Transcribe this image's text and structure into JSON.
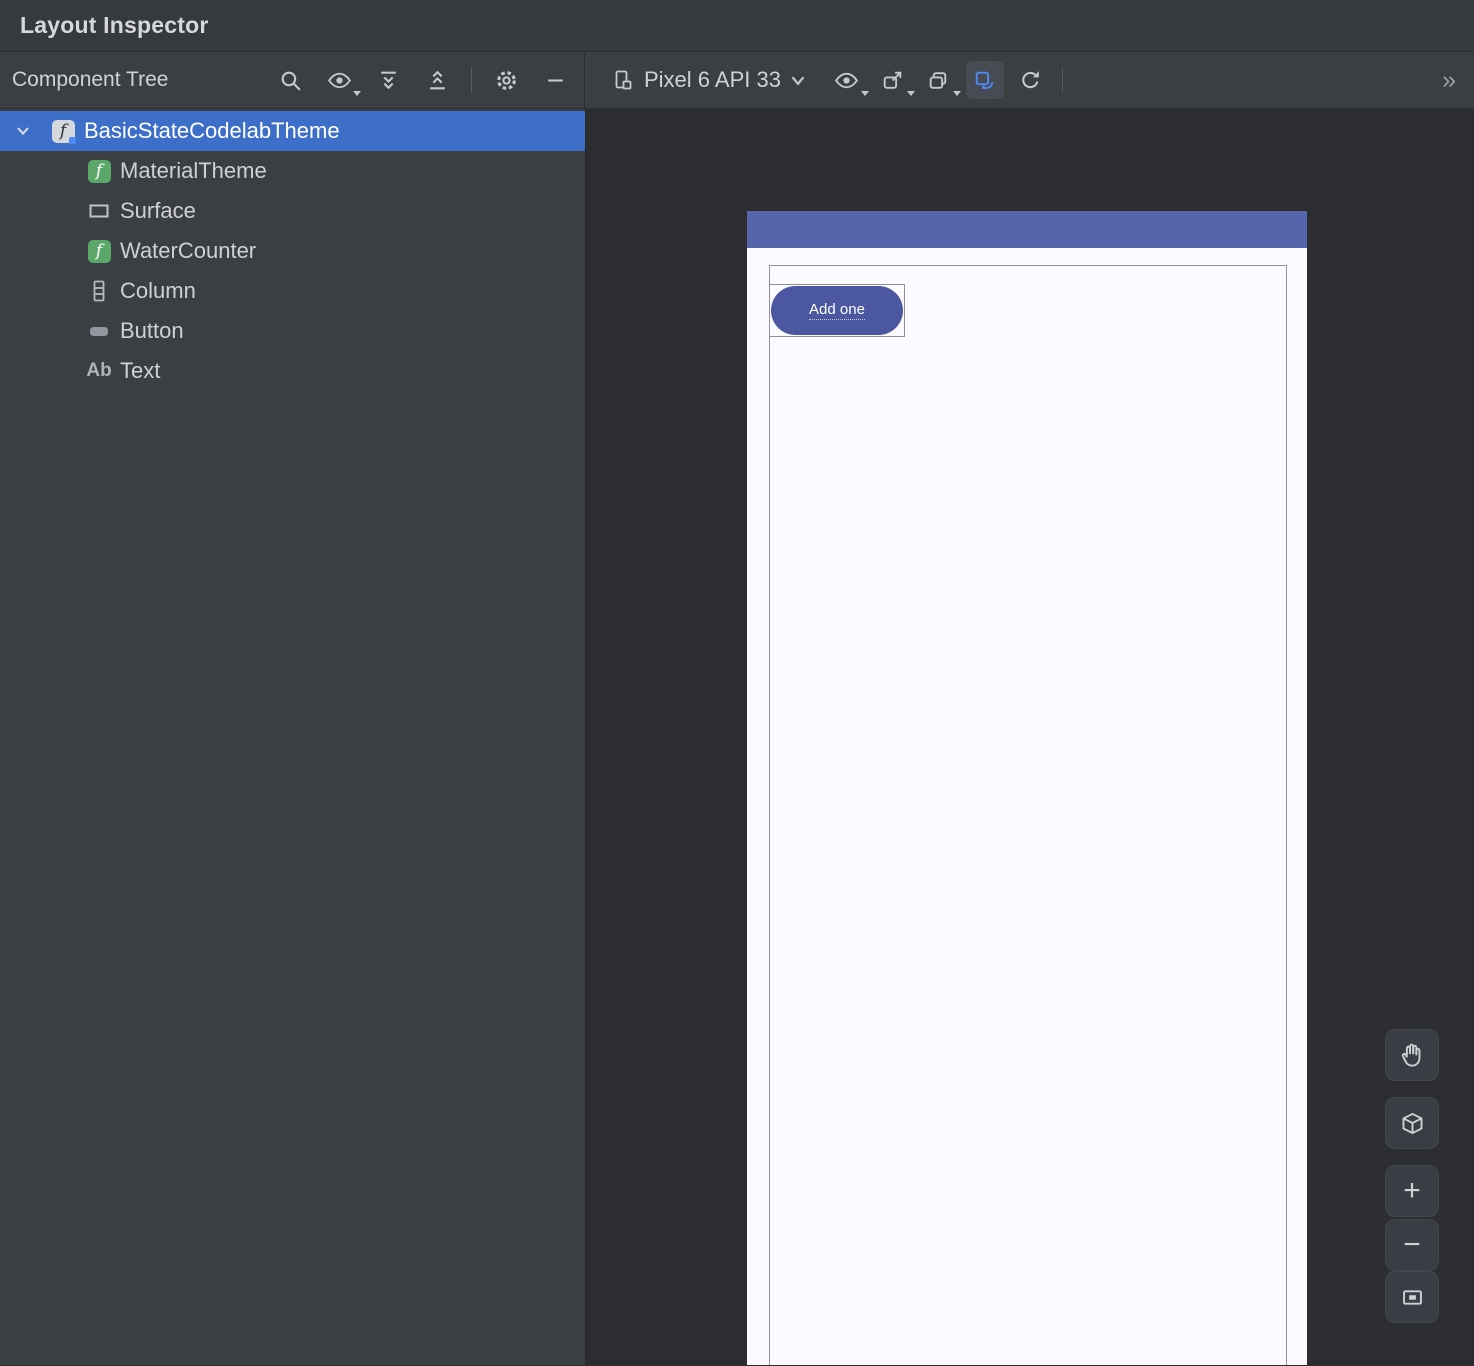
{
  "window": {
    "title": "Layout Inspector"
  },
  "toolbar": {
    "tree_header": "Component Tree",
    "device_selector": "Pixel 6 API 33",
    "overflow_glyph": "»"
  },
  "component_tree": {
    "composable_icon_glyph": "f",
    "text_icon_glyph": "Ab",
    "items": [
      {
        "label": "BasicStateCodelabTheme",
        "type": "composable",
        "selected": true,
        "expanded": true
      },
      {
        "label": "MaterialTheme",
        "type": "composable",
        "selected": false
      },
      {
        "label": "Surface",
        "type": "surface",
        "selected": false
      },
      {
        "label": "WaterCounter",
        "type": "composable",
        "selected": false
      },
      {
        "label": "Column",
        "type": "column",
        "selected": false
      },
      {
        "label": "Button",
        "type": "button",
        "selected": false
      },
      {
        "label": "Text",
        "type": "text",
        "selected": false
      }
    ]
  },
  "device_screen": {
    "button_label": "Add one"
  },
  "zoom_controls": {
    "zoom_in_glyph": "+",
    "zoom_out_glyph": "−"
  },
  "colors": {
    "selection": "#3d6fc9",
    "accent_blue": "#4e8bf8",
    "app_bar": "#5565ab",
    "compose_button": "#4b57a1",
    "panel_bg": "#3c3f41",
    "canvas_bg": "#2b2d30",
    "composable_icon_green": "#59a869"
  }
}
